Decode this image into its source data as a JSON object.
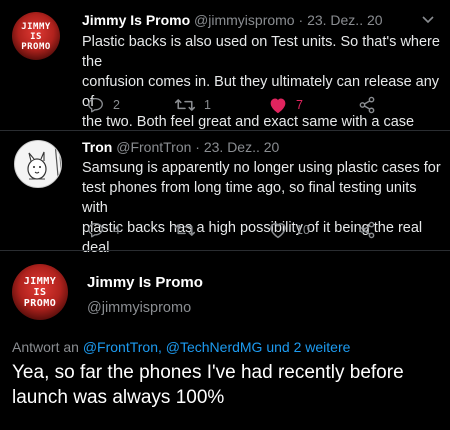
{
  "tweets": [
    {
      "name": "Jimmy Is Promo",
      "handle": "@jimmyispromo",
      "date": "23. Dez.. 20",
      "avatar_text": [
        "JIMMY",
        "IS",
        "PROMO"
      ],
      "text_lines": [
        "Plastic backs is also used on Test units. So that's where the",
        "confusion comes in. But they ultimately can release any of",
        "the two. Both feel great and exact same with a case"
      ],
      "replies": "2",
      "retweets": "1",
      "likes": "7",
      "liked": true
    },
    {
      "name": "Tron",
      "handle": "@FrontTron",
      "date": "23. Dez.. 20",
      "text_lines": [
        "Samsung is apparently no longer using plastic cases for",
        "test phones from long time ago, so final testing units with",
        "plastic backs has a high possibility of it being the real deal"
      ],
      "replies": "4",
      "retweets": "",
      "likes": "10"
    }
  ],
  "main_tweet": {
    "name": "Jimmy Is Promo",
    "handle": "@jimmyispromo",
    "avatar_text": [
      "JIMMY",
      "IS",
      "PROMO"
    ],
    "reply_prefix": "Antwort an ",
    "reply_links": "@FrontTron, @TechNerdMG",
    "reply_suffix": " und 2 weitere",
    "text_lines": [
      "Yea, so far the phones I've had recently before",
      "launch was always 100%"
    ]
  },
  "colors": {
    "background": "#000000",
    "link": "#1d9bf0",
    "like": "#e0245e",
    "muted": "#8a8d91"
  },
  "icons": [
    "reply-icon",
    "retweet-icon",
    "heart-icon",
    "share-icon",
    "chevron-down-icon"
  ]
}
